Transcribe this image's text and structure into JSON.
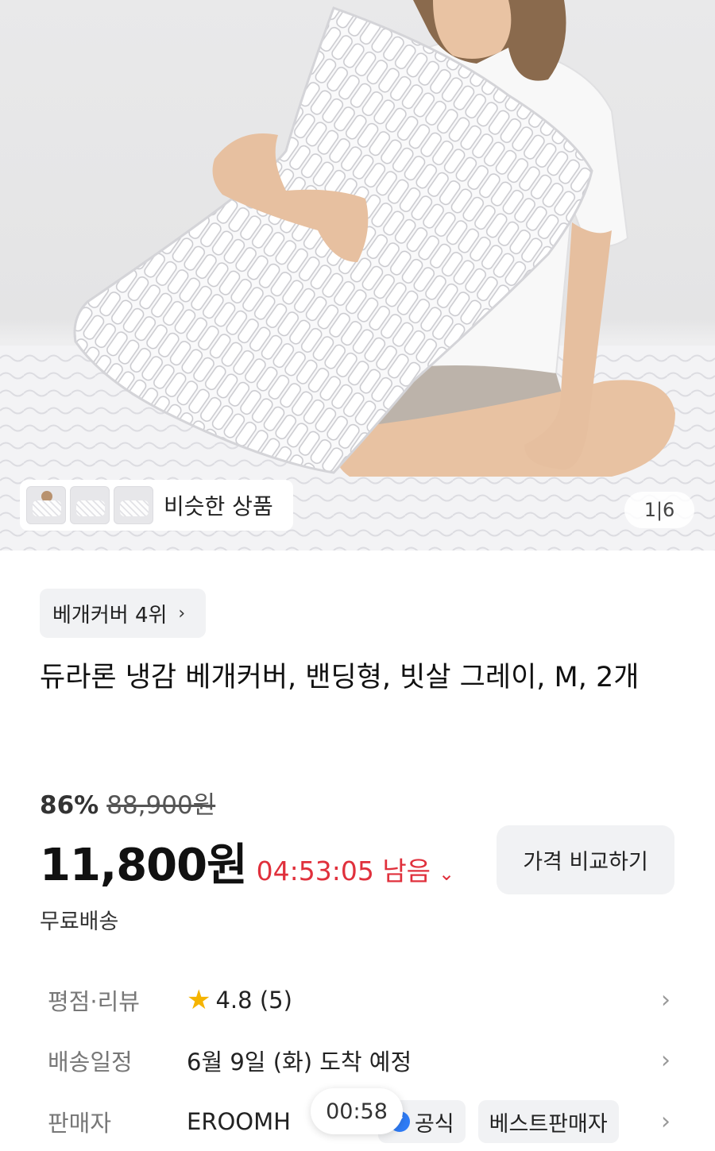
{
  "hero": {
    "similar_label": "비슷한 상품",
    "image_counter": "1|6"
  },
  "rank_chip": {
    "label": "베개커버 4위",
    "chevron": "›"
  },
  "product": {
    "title": "듀라론 냉감 베개커버, 밴딩형, 빗살 그레이, M, 2개",
    "discount": "86%",
    "original_price": "88,900원",
    "price": "11,800원",
    "countdown": "04:53:05 남음",
    "countdown_chevron": "⌄",
    "compare_button": "가격 비교하기",
    "shipping": "무료배송"
  },
  "info": {
    "rating_label": "평점·리뷰",
    "rating_value": "4.8 (5)",
    "delivery_label": "배송일정",
    "delivery_value": "6월 9일 (화) 도착 예정",
    "seller_label": "판매자",
    "seller_value": "EROOMH",
    "official_badge": "공식",
    "best_seller_badge": "베스트판매자",
    "chevron": "›"
  },
  "overlay_timer": "00:58",
  "colors": {
    "accent_red": "#e0303c",
    "chip_bg": "#f1f2f4",
    "star": "#f5b400",
    "verified_blue": "#2f7cf6"
  },
  "icons": [
    "star-icon",
    "verified-check-icon",
    "chevron-right-icon",
    "chevron-down-icon"
  ]
}
